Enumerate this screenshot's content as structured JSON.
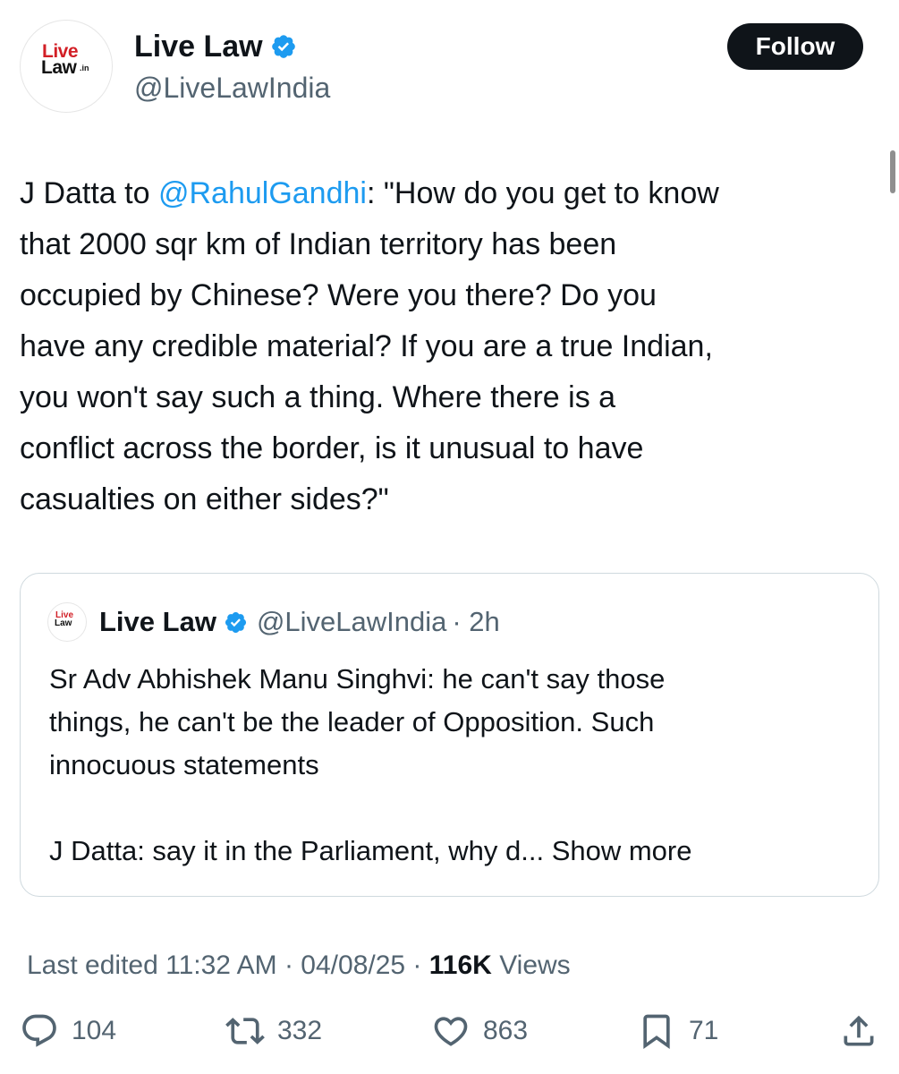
{
  "author": {
    "name": "Live Law",
    "handle": "@LiveLawIndia",
    "logo_top": "Live",
    "logo_bottom": "Law",
    "logo_suffix": ".in",
    "verified": true
  },
  "follow_label": "Follow",
  "tweet": {
    "lines": [
      {
        "pre": "J Datta to ",
        "mention": "@RahulGandhi",
        "post": ": \"How do you get to know"
      },
      {
        "text": "that 2000 sqr km of Indian territory has been"
      },
      {
        "text": "occupied by Chinese? Were you there? Do you"
      },
      {
        "text": "have any credible material? If you are a true Indian,"
      },
      {
        "text": "you won't say such a thing. Where there is a"
      },
      {
        "text": "conflict across the border, is it unusual to have"
      },
      {
        "text": "casualties on either sides?\""
      }
    ]
  },
  "quote": {
    "name": "Live Law",
    "handle": "@LiveLawIndia",
    "time": "· 2h",
    "lines": [
      "Sr Adv Abhishek Manu Singhvi: he can't say those",
      "things, he can't be the leader of Opposition. Such",
      "innocuous statements",
      "",
      "J Datta: say it in the Parliament, why d..."
    ],
    "show_more": "Show more"
  },
  "meta": {
    "edited": "Last edited 11:32 AM · 04/08/25",
    "separator": "·",
    "views_count": "116K",
    "views_label": "Views"
  },
  "actions": {
    "replies": "104",
    "reposts": "332",
    "likes": "863",
    "bookmarks": "71"
  },
  "colors": {
    "accent": "#1d9bf0",
    "text": "#0f1419",
    "secondary": "#536471",
    "brand_red": "#d21f26"
  }
}
